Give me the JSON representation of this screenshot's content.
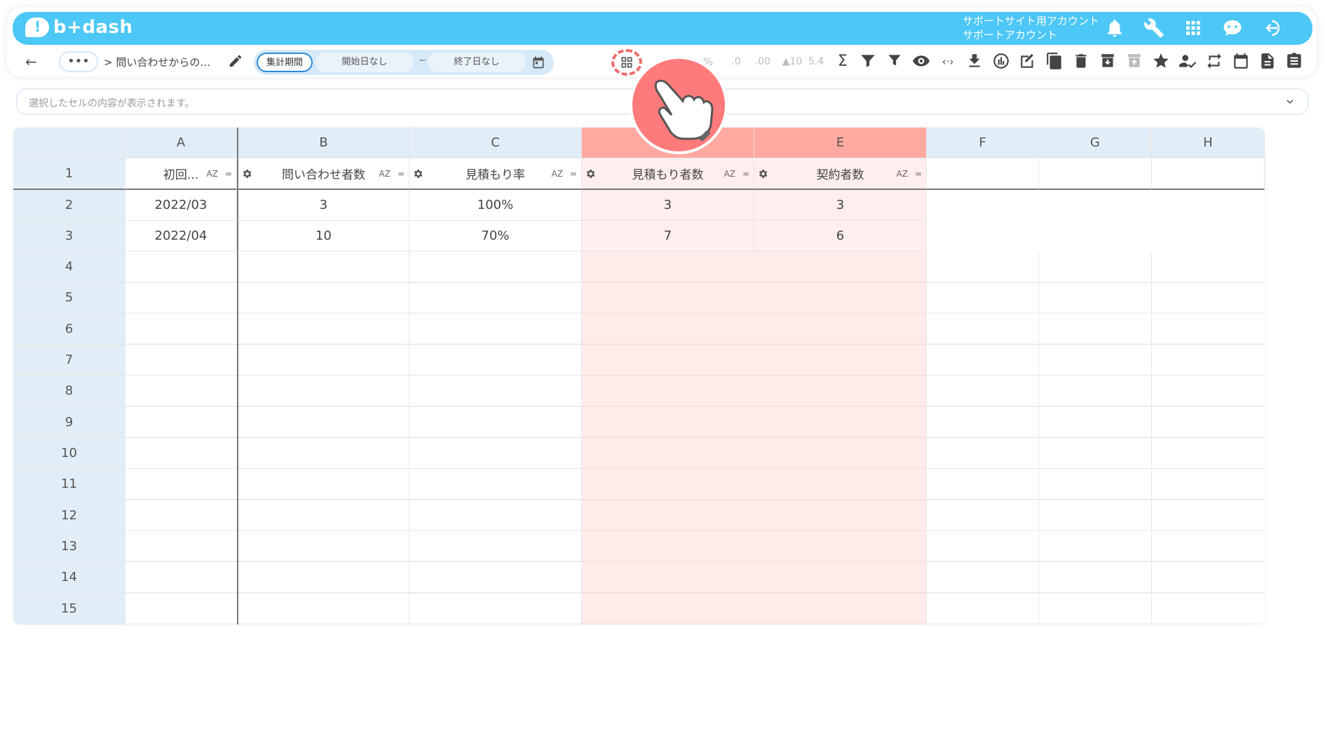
{
  "app": {
    "logo_text": "b+dash",
    "account_line1": "サポートサイト用アカウント",
    "account_line2": "サポートアカウント"
  },
  "toolbar": {
    "back_icon": "←",
    "more_label": "•••",
    "breadcrumb": "> 問い合わせからの…",
    "period_label": "集計期間",
    "start_date": "開始日なし",
    "tilde": "~",
    "end_date": "終了日なし"
  },
  "infobar": {
    "placeholder": "選択したセルの内容が表示されます。"
  },
  "columns": [
    "A",
    "B",
    "C",
    "",
    "E",
    "F",
    "G",
    "H"
  ],
  "rows": [
    "1",
    "2",
    "3",
    "4",
    "5",
    "6",
    "7",
    "8",
    "9",
    "10",
    "11",
    "12",
    "13",
    "14",
    "15"
  ],
  "headers": [
    "初回...",
    "問い合わせ者数",
    "見積もり率",
    "見積もり者数",
    "契約者数"
  ],
  "sort_label": "AZ",
  "filter_label": "=",
  "data": [
    [
      "2022/03",
      "3",
      "100%",
      "3",
      "3"
    ],
    [
      "2022/04",
      "10",
      "70%",
      "7",
      "6"
    ]
  ],
  "icons": [
    "bell-icon",
    "wrench-icon",
    "apps-icon",
    "chat-robot-icon",
    "logout-icon",
    "pencil-icon",
    "calendar-icon",
    "grid-icon",
    "sigma-icon",
    "filter-icon",
    "eye-icon",
    "code-icon",
    "download-icon",
    "chart-icon",
    "edit-icon",
    "copy-icon",
    "trash-icon",
    "archive-icon",
    "star-icon",
    "user-check-icon",
    "repeat-icon",
    "document-icon",
    "clipboard-icon",
    "hand-pointer-icon"
  ],
  "toolbar_glyphs": {
    "percent": "%",
    "dec_minus": ".0",
    "dec_plus": ".00",
    "up10": "▲10",
    "fmt": "5.4"
  },
  "colors": {
    "brand": "#4cc7f6",
    "highlight_header": "#ffa9a0",
    "highlight_cell": "#ffeeed",
    "header_bg": "#e1eef8",
    "pointer": "#ff7a7a"
  }
}
